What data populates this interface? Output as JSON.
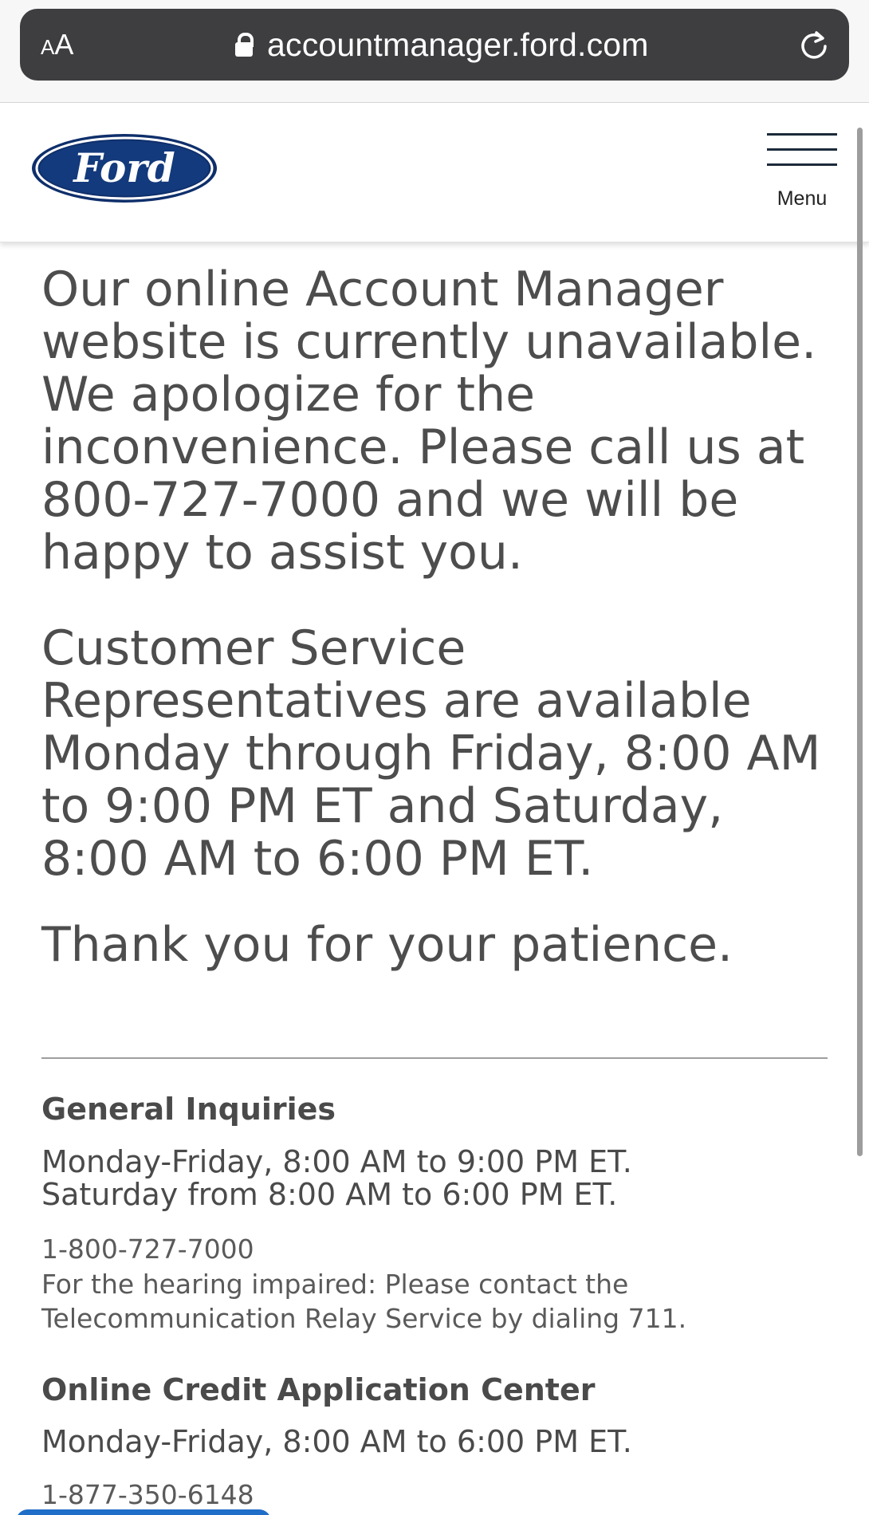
{
  "browser": {
    "text_size_small": "A",
    "text_size_large": "A",
    "url": "accountmanager.ford.com"
  },
  "header": {
    "logo_text": "Ford",
    "menu_label": "Menu"
  },
  "main": {
    "message_unavailable": "Our online Account Manager website is currently unavailable. We apologize for the inconvenience. Please call us at 800-727-7000 and we will be happy to assist you.",
    "message_hours": "Customer Service Representatives are available Monday through Friday, 8:00 AM to 9:00 PM ET and Saturday, 8:00 AM to 6:00 PM ET.",
    "message_thanks": "Thank you for your patience."
  },
  "contacts": {
    "general": {
      "title": "General Inquiries",
      "hours_line1": "Monday-Friday, 8:00 AM to 9:00 PM ET.",
      "hours_line2": "Saturday from 8:00 AM to 6:00 PM ET.",
      "phone": "1-800-727-7000",
      "hearing_line1": "For the hearing impaired: Please contact the",
      "hearing_line2": "Telecommunication Relay Service by dialing 711."
    },
    "credit": {
      "title": "Online Credit Application Center",
      "hours_line1": "Monday-Friday, 8:00 AM to 6:00 PM ET.",
      "phone": "1-877-350-6148"
    }
  },
  "colors": {
    "ford_blue": "#133a7c",
    "text_gray": "#4d4d4d",
    "address_bar": "#3e3e40"
  }
}
